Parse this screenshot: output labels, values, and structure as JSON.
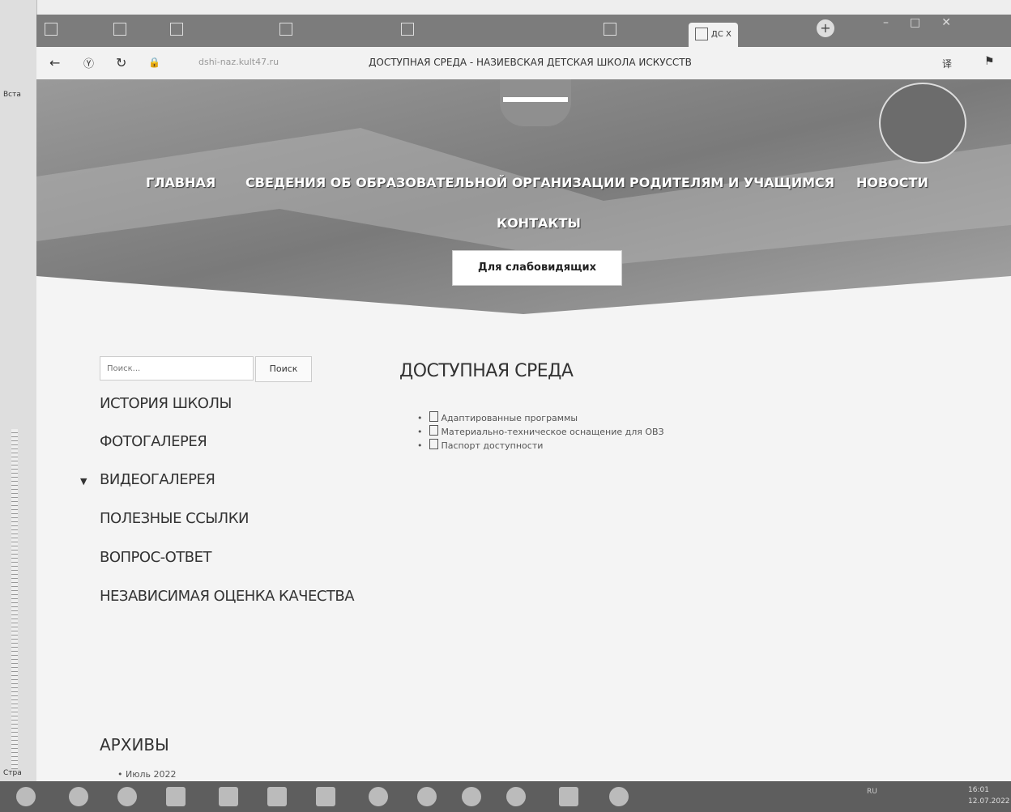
{
  "left_strip": {
    "top_label": "Вста",
    "bottom_label": "Стра"
  },
  "browser": {
    "tabs": [
      {
        "label": "",
        "active": false
      },
      {
        "label": "",
        "active": false
      },
      {
        "label": "",
        "active": false
      },
      {
        "label": "",
        "active": false
      },
      {
        "label": "",
        "active": false
      },
      {
        "label": "ДС Х",
        "active": true
      }
    ],
    "url": "dshi-naz.kult47.ru",
    "page_title": "ДОСТУПНАЯ СРЕДА - НАЗИЕВСКАЯ ДЕТСКАЯ ШКОЛА ИСКУССТВ"
  },
  "site": {
    "nav": [
      "ГЛАВНАЯ",
      "СВЕДЕНИЯ ОБ ОБРАЗОВАТЕЛЬНОЙ ОРГАНИЗАЦИИ",
      "РОДИТЕЛЯМ И УЧАЩИМСЯ",
      "НОВОСТИ",
      "КОНТАКТЫ"
    ],
    "low_vision_button": "Для слабовидящих",
    "search": {
      "placeholder": "Поиск...",
      "button": "Поиск"
    },
    "sidebar": [
      "ИСТОРИЯ ШКОЛЫ",
      "ФОТОГАЛЕРЕЯ",
      "ВИДЕОГАЛЕРЕЯ",
      "ПОЛЕЗНЫЕ ССЫЛКИ",
      "ВОПРОС-ОТВЕТ",
      "НЕЗАВИСИМАЯ ОЦЕНКА КАЧЕСТВА"
    ],
    "content_title": "ДОСТУПНАЯ СРЕДА",
    "documents": [
      "Адаптированные программы",
      "Материально-техническое оснащение для ОВЗ",
      "Паспорт доступности"
    ],
    "archives_title": "АРХИВЫ",
    "archives": [
      "Июль 2022"
    ]
  },
  "taskbar": {
    "tray_lang": "RU",
    "clock_time": "16:01",
    "clock_date": "12.07.2022"
  }
}
